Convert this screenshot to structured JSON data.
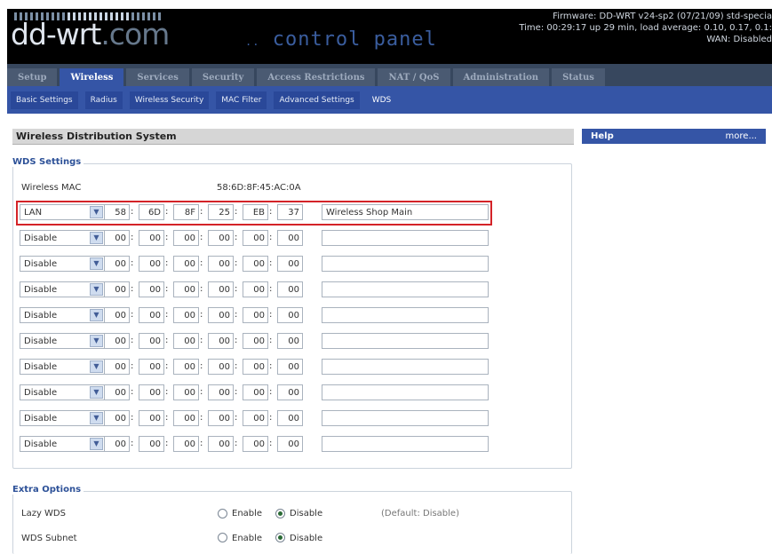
{
  "header": {
    "logo": "dd-wrt",
    "logo_suffix": ".com",
    "subtitle": "control panel",
    "firmware": "Firmware: DD-WRT v24-sp2 (07/21/09) std-specia",
    "time": "Time: 00:29:17 up 29 min, load average: 0.10, 0.17, 0.1:",
    "wan": "WAN: Disabled"
  },
  "tabs": [
    "Setup",
    "Wireless",
    "Services",
    "Security",
    "Access Restrictions",
    "NAT / QoS",
    "Administration",
    "Status"
  ],
  "active_tab": "Wireless",
  "subtabs": [
    "Basic Settings",
    "Radius",
    "Wireless Security",
    "MAC Filter",
    "Advanced Settings",
    "WDS"
  ],
  "active_subtab": "WDS",
  "section_title": "Wireless Distribution System",
  "help": {
    "title": "Help",
    "more": "more..."
  },
  "wds_settings": {
    "legend": "WDS Settings",
    "mac_label": "Wireless MAC",
    "mac_value": "58:6D:8F:45:AC:0A",
    "rows": [
      {
        "mode": "LAN",
        "mac": [
          "58",
          "6D",
          "8F",
          "25",
          "EB",
          "37"
        ],
        "name": "Wireless Shop Main"
      },
      {
        "mode": "Disable",
        "mac": [
          "00",
          "00",
          "00",
          "00",
          "00",
          "00"
        ],
        "name": ""
      },
      {
        "mode": "Disable",
        "mac": [
          "00",
          "00",
          "00",
          "00",
          "00",
          "00"
        ],
        "name": ""
      },
      {
        "mode": "Disable",
        "mac": [
          "00",
          "00",
          "00",
          "00",
          "00",
          "00"
        ],
        "name": ""
      },
      {
        "mode": "Disable",
        "mac": [
          "00",
          "00",
          "00",
          "00",
          "00",
          "00"
        ],
        "name": ""
      },
      {
        "mode": "Disable",
        "mac": [
          "00",
          "00",
          "00",
          "00",
          "00",
          "00"
        ],
        "name": ""
      },
      {
        "mode": "Disable",
        "mac": [
          "00",
          "00",
          "00",
          "00",
          "00",
          "00"
        ],
        "name": ""
      },
      {
        "mode": "Disable",
        "mac": [
          "00",
          "00",
          "00",
          "00",
          "00",
          "00"
        ],
        "name": ""
      },
      {
        "mode": "Disable",
        "mac": [
          "00",
          "00",
          "00",
          "00",
          "00",
          "00"
        ],
        "name": ""
      },
      {
        "mode": "Disable",
        "mac": [
          "00",
          "00",
          "00",
          "00",
          "00",
          "00"
        ],
        "name": ""
      }
    ]
  },
  "extra_options": {
    "legend": "Extra Options",
    "lazy_wds": {
      "label": "Lazy WDS",
      "enable": "Enable",
      "disable": "Disable",
      "selected": "Disable",
      "default": "(Default: Disable)"
    },
    "wds_subnet": {
      "label": "WDS Subnet",
      "enable": "Enable",
      "disable": "Disable",
      "selected": "Disable"
    }
  },
  "colors": {
    "accent": "#3555a6",
    "highlight_outline": "#d42328",
    "tab_bar": "#37475e"
  }
}
